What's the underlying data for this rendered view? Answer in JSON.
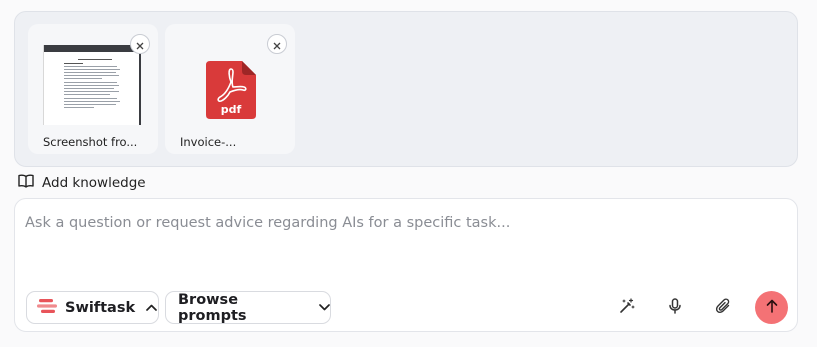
{
  "attachments": [
    {
      "name": "Screenshot fro...",
      "kind": "image"
    },
    {
      "name": "Invoice-...",
      "kind": "pdf",
      "badge": "pdf"
    }
  ],
  "add_knowledge": {
    "label": "Add knowledge",
    "icon": "book-icon"
  },
  "composer": {
    "placeholder": "Ask a question or request advice regarding AIs for a specific task...",
    "value": ""
  },
  "toolbar": {
    "assistant": {
      "label": "Swiftask",
      "icon": "swiftask-logo"
    },
    "browse_prompts": {
      "label": "Browse prompts"
    },
    "tools": [
      "magic-wand-icon",
      "microphone-icon",
      "paperclip-icon"
    ],
    "send": {
      "icon": "arrow-up-icon"
    }
  },
  "colors": {
    "send_button": "#f47275",
    "pdf_red": "#d93a3a",
    "logo_red": "#e8545a"
  }
}
